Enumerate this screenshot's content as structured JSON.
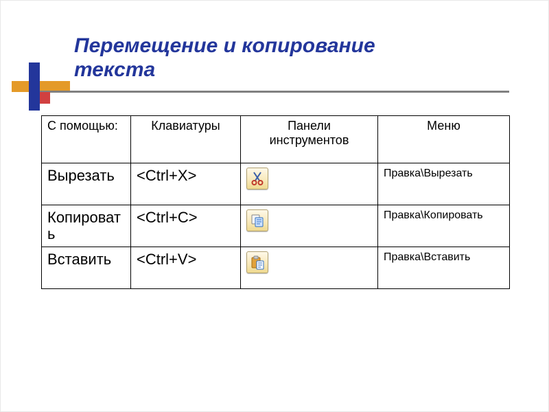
{
  "title_line1": "Перемещение и копирование",
  "title_line2": "текста",
  "headers": {
    "using": "С помощью:",
    "keyboard": "Клавиатуры",
    "toolbar": "Панели инструментов",
    "menu": "Меню"
  },
  "rows": {
    "cut": {
      "action": "Вырезать",
      "key": "<Ctrl+X>",
      "icon": "scissors-icon",
      "menu": "Правка\\Вырезать"
    },
    "copy": {
      "action": "Копировать",
      "key": "<Ctrl+C>",
      "icon": "copy-icon",
      "menu": "Правка\\Копировать"
    },
    "paste": {
      "action": "Вставить",
      "key": "<Ctrl+V>",
      "icon": "paste-icon",
      "menu": "Правка\\Вставить"
    }
  }
}
